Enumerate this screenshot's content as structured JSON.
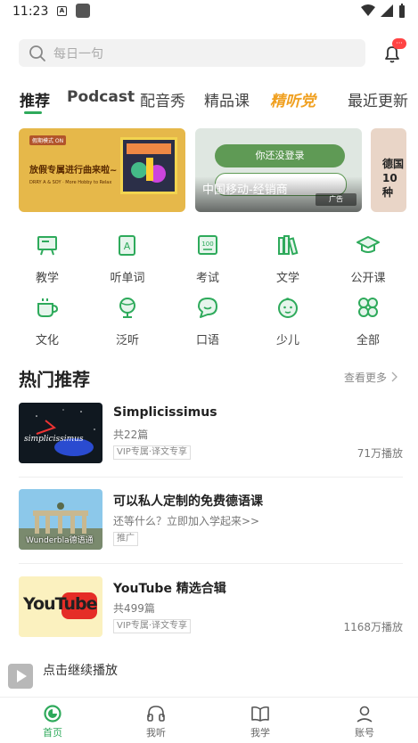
{
  "status_bar": {
    "time": "11:23",
    "notif_letter": "A"
  },
  "search": {
    "placeholder": "每日一句"
  },
  "header": {
    "bell_badge": "···"
  },
  "tabs": [
    {
      "label": "推荐",
      "active": true
    },
    {
      "label": "Podcast"
    },
    {
      "label": "配音秀"
    },
    {
      "label": "精品课"
    },
    {
      "label": "精听党"
    },
    {
      "label": "最近更新"
    }
  ],
  "banners": {
    "b1": {
      "tag": "假期模式 ON",
      "title": "放假专属进行曲来啦~",
      "sub": "DRRY A & SOY · More Hobby to Relax"
    },
    "b2": {
      "login": "你还没登录",
      "label": "中国移动-经销商",
      "ad": "广告"
    },
    "b3": {
      "text": "德国 10种"
    }
  },
  "categories": [
    {
      "label": "教学",
      "icon": "teaching-board-icon"
    },
    {
      "label": "听单词",
      "icon": "word-card-icon"
    },
    {
      "label": "考试",
      "icon": "exam-100-icon"
    },
    {
      "label": "文学",
      "icon": "books-icon"
    },
    {
      "label": "公开课",
      "icon": "graduation-cap-icon"
    },
    {
      "label": "文化",
      "icon": "coffee-cup-icon"
    },
    {
      "label": "泛听",
      "icon": "globe-icon"
    },
    {
      "label": "口语",
      "icon": "speech-bubble-icon"
    },
    {
      "label": "少儿",
      "icon": "child-face-icon"
    },
    {
      "label": "全部",
      "icon": "four-leaf-icon"
    }
  ],
  "section": {
    "title": "热门推荐",
    "more": "查看更多"
  },
  "items": [
    {
      "title": "Simplicissimus",
      "sub": "共22篇",
      "tag": "VIP专属·译文专享",
      "plays": "71万播放",
      "thumb_text": "simplicissimus"
    },
    {
      "title": "可以私人定制的免费德语课",
      "sub": "还等什么？立即加入学起来>>",
      "tag": "推广",
      "plays": "",
      "thumb_text": "Wunderbla德语通"
    },
    {
      "title": "YouTube 精选合辑",
      "sub": "共499篇",
      "tag": "VIP专属·译文专享",
      "plays": "1168万播放",
      "thumb_text": "YouTube"
    }
  ],
  "mini_player": {
    "text": "点击继续播放"
  },
  "bottom_nav": [
    {
      "label": "首页",
      "active": true
    },
    {
      "label": "我听"
    },
    {
      "label": "我学"
    },
    {
      "label": "账号"
    }
  ],
  "colors": {
    "accent": "#2eaa5b",
    "special_tab": "#f0a020"
  }
}
